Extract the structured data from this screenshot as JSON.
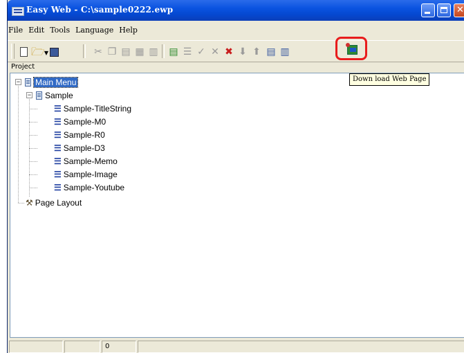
{
  "window": {
    "title": "Easy Web - C:\\sample0222.ewp"
  },
  "menu": [
    {
      "label": "File"
    },
    {
      "label": "Edit"
    },
    {
      "label": "Tools"
    },
    {
      "label": "Language"
    },
    {
      "label": "Help"
    }
  ],
  "toolbar": {
    "icons": [
      "new-document-icon",
      "open-folder-icon",
      "dropdown-arrow-icon",
      "save-icon",
      "cut-icon",
      "copy-icon",
      "paste-icon",
      "add-node-icon",
      "remove-node-icon",
      "add-item-icon",
      "add-list-icon",
      "check-icon",
      "delete-icon",
      "delete-item-icon",
      "move-down-icon",
      "move-up-icon",
      "properties-icon",
      "page-icon",
      "download-web-page-icon"
    ],
    "highlight_color": "#e81c1c"
  },
  "panel": {
    "label": "Project"
  },
  "tree": {
    "root": {
      "label": "Main Menu",
      "expanded": true,
      "selected": true
    },
    "sample": {
      "label": "Sample",
      "expanded": true
    },
    "children": [
      {
        "label": "Sample-TitleString"
      },
      {
        "label": "Sample-M0"
      },
      {
        "label": "Sample-R0"
      },
      {
        "label": "Sample-D3"
      },
      {
        "label": "Sample-Memo"
      },
      {
        "label": "Sample-Image"
      },
      {
        "label": "Sample-Youtube"
      }
    ],
    "layout": {
      "label": "Page Layout"
    }
  },
  "tooltip": {
    "text": "Down load Web Page"
  },
  "statusbar": {
    "value": "0"
  },
  "colors": {
    "titlebar": "#0a53e0",
    "selection": "#316ac5",
    "tooltip_bg": "#ffffe1"
  }
}
